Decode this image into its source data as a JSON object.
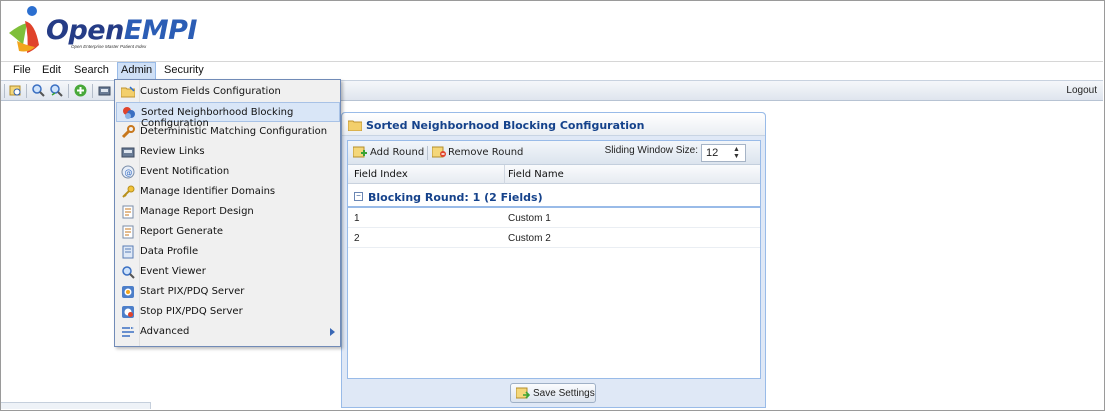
{
  "app": {
    "logo_open": "Open",
    "logo_empi": "EMPI",
    "logo_subtitle": "Open Enterprise Master Patient Index"
  },
  "menubar": {
    "items": [
      "File",
      "Edit",
      "Search",
      "Admin",
      "Security"
    ],
    "active": "Admin"
  },
  "toolbar": {
    "icons": [
      "search-records-icon",
      "zoom-icon",
      "zoom-back-icon",
      "add-icon",
      "keyboard-icon"
    ],
    "logout_label": "Logout"
  },
  "admin_menu": {
    "items": [
      {
        "label": "Custom Fields Configuration",
        "icon": "folder-icon"
      },
      {
        "label": "Sorted Neighborhood Blocking Configuration",
        "icon": "blocking-icon"
      },
      {
        "label": "Deterministic Matching Configuration",
        "icon": "wrench-icon"
      },
      {
        "label": "Review Links",
        "icon": "keyboard-icon"
      },
      {
        "label": "Event Notification",
        "icon": "mail-icon"
      },
      {
        "label": "Manage Identifier Domains",
        "icon": "key-icon"
      },
      {
        "label": "Manage Report Design",
        "icon": "report-icon"
      },
      {
        "label": "Report Generate",
        "icon": "report-icon"
      },
      {
        "label": "Data Profile",
        "icon": "document-icon"
      },
      {
        "label": "Event Viewer",
        "icon": "magnifier-icon"
      },
      {
        "label": "Start PIX/PDQ Server",
        "icon": "server-start-icon"
      },
      {
        "label": "Stop PIX/PDQ Server",
        "icon": "server-stop-icon"
      },
      {
        "label": "Advanced",
        "icon": "advanced-icon"
      }
    ],
    "highlighted": "Sorted Neighborhood Blocking Configuration"
  },
  "panel": {
    "title": "Sorted Neighborhood Blocking Configuration",
    "add_round_label": "Add Round",
    "remove_round_label": "Remove Round",
    "sliding_window_label": "Sliding Window Size:",
    "sliding_window_value": "12",
    "columns": [
      "Field Index",
      "Field Name"
    ],
    "group_label": "Blocking Round: 1 (2 Fields)",
    "group_toggle": "−",
    "rows": [
      {
        "index": "1",
        "name": "Custom 1"
      },
      {
        "index": "2",
        "name": "Custom 2"
      }
    ],
    "save_label": "Save Settings"
  },
  "colors": {
    "accent": "#15428b",
    "panel_border": "#99bbe8",
    "menu_highlight": "#d9e6f7"
  }
}
